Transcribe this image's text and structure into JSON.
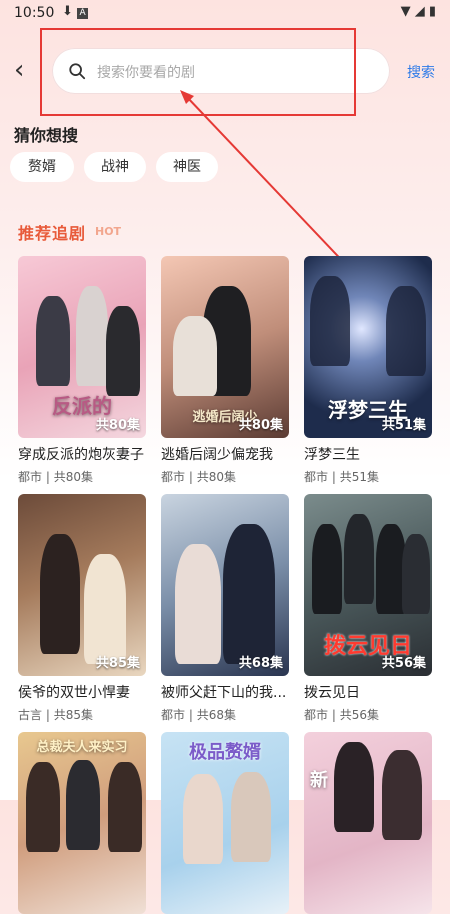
{
  "status": {
    "time": "10:50"
  },
  "search": {
    "placeholder": "搜索你要看的剧",
    "button": "搜索"
  },
  "guess": {
    "title": "猜你想搜",
    "chips": [
      "赘婿",
      "战神",
      "神医"
    ]
  },
  "recommend": {
    "title": "推荐追剧",
    "hot": "HOT",
    "items": [
      {
        "title": "穿成反派的炮灰妻子",
        "genre": "都市",
        "episodes": "共80集",
        "poster_text": "反派的"
      },
      {
        "title": "逃婚后阔少偏宠我",
        "genre": "都市",
        "episodes": "共80集",
        "poster_text": "逃婚后阔少"
      },
      {
        "title": "浮梦三生",
        "genre": "都市",
        "episodes": "共51集",
        "poster_text": "浮梦三生"
      },
      {
        "title": "侯爷的双世小悍妻",
        "genre": "古言",
        "episodes": "共85集",
        "poster_text": ""
      },
      {
        "title": "被师父赶下山的我...",
        "genre": "都市",
        "episodes": "共68集",
        "poster_text": ""
      },
      {
        "title": "拨云见日",
        "genre": "都市",
        "episodes": "共56集",
        "poster_text": "拨云见日"
      },
      {
        "title": "",
        "genre": "",
        "episodes": "",
        "poster_text": "总裁夫人来实习"
      },
      {
        "title": "",
        "genre": "",
        "episodes": "",
        "poster_text": "极品赘婿"
      },
      {
        "title": "",
        "genre": "",
        "episodes": "",
        "poster_text": "新"
      }
    ]
  },
  "separator": "|",
  "colors": {
    "accent": "#2e7be8",
    "rec_title": "#e85a3a",
    "annotation": "#e53935"
  }
}
